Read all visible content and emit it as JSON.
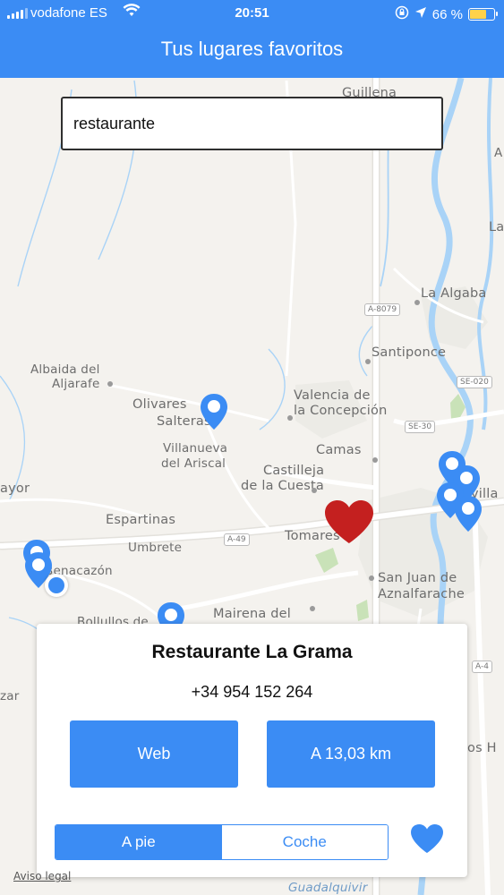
{
  "status_bar": {
    "carrier": "vodafone ES",
    "time": "20:51",
    "battery": "66 %",
    "battery_level": 0.66
  },
  "header": {
    "title": "Tus lugares favoritos"
  },
  "search": {
    "value": "restaurante"
  },
  "map": {
    "places": {
      "guillena": "Guillena",
      "la_algaba": "La Algaba",
      "santiponce": "Santiponce",
      "albaida_1": "Albaida del",
      "albaida_2": "Aljarafe",
      "olivares": "Olivares",
      "salteras": "Salteras",
      "valencia_1": "Valencia de",
      "valencia_2": "la Concepción",
      "villanueva_1": "Villanueva",
      "villanueva_2": "del Ariscal",
      "camas": "Camas",
      "castilleja_1": "Castilleja",
      "castilleja_2": "de la Cuesta",
      "espartinas": "Espartinas",
      "umbrete": "Umbrete",
      "tomares": "Tomares",
      "san_juan_1": "San Juan de",
      "san_juan_2": "Aznalfarache",
      "benacazon": "Benacazón",
      "bollullos": "Bollullos de",
      "mairena": "Mairena del",
      "mayor": "ayor",
      "zar": "zar",
      "sevilla_fragment": "villa",
      "dos_h": "os H",
      "la_edge": "La",
      "a_edge": "A",
      "guadalquivir": "Guadalquivir"
    },
    "road_shields": {
      "a8079": "A-8079",
      "se020": "SE-020",
      "se30": "SE-30",
      "a49": "A-49",
      "a4": "A-4"
    },
    "legal": "Aviso legal"
  },
  "detail": {
    "name": "Restaurante La Grama",
    "phone": "+34 954 152 264",
    "web_label": "Web",
    "distance_label": "A 13,03 km",
    "modes": [
      "A pie",
      "Coche"
    ],
    "selected_mode": "A pie"
  },
  "colors": {
    "accent": "#3b8cf4",
    "favorite_marker": "#c4201f",
    "map_background": "#f4f2ee",
    "river": "#a9d3f7",
    "road": "#ffffff"
  },
  "icons": {
    "wifi": "wifi-icon",
    "location_arrow": "location-arrow-icon",
    "rotation_lock": "rotation-lock-icon",
    "heart": "heart-icon",
    "pin": "map-pin-icon"
  }
}
